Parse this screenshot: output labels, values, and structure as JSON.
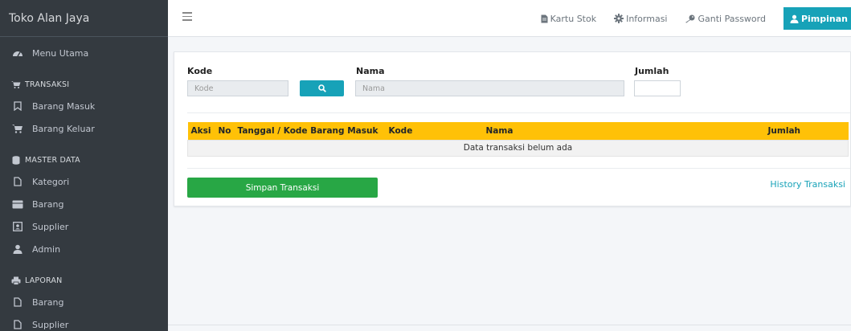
{
  "sidebar": {
    "brand": "Toko Alan Jaya",
    "menu_utama": "Menu Utama",
    "sections": [
      {
        "header": "TRANSAKSI",
        "items": [
          "Barang Masuk",
          "Barang Keluar"
        ]
      },
      {
        "header": "MASTER DATA",
        "items": [
          "Kategori",
          "Barang",
          "Supplier",
          "Admin"
        ]
      },
      {
        "header": "LAPORAN",
        "items": [
          "Barang",
          "Supplier"
        ]
      }
    ]
  },
  "topbar": {
    "kartu_stok": "Kartu Stok",
    "informasi": "Informasi",
    "ganti_password": "Ganti Password",
    "user": "Pimpinan"
  },
  "form": {
    "kode_label": "Kode",
    "kode_placeholder": "Kode",
    "nama_label": "Nama",
    "nama_placeholder": "Nama",
    "jumlah_label": "Jumlah",
    "jumlah_value": ""
  },
  "table": {
    "headers": [
      "Aksi",
      "No",
      "Tanggal / Kode Barang Masuk",
      "Kode",
      "Nama",
      "Jumlah"
    ],
    "empty_text": "Data transaksi belum ada"
  },
  "actions": {
    "simpan": "Simpan Transaksi",
    "history": "History Transaksi"
  },
  "colors": {
    "sidebar_bg": "#343a40",
    "accent": "#17a2b8",
    "table_header": "#ffc107",
    "save_button": "#28a745"
  }
}
